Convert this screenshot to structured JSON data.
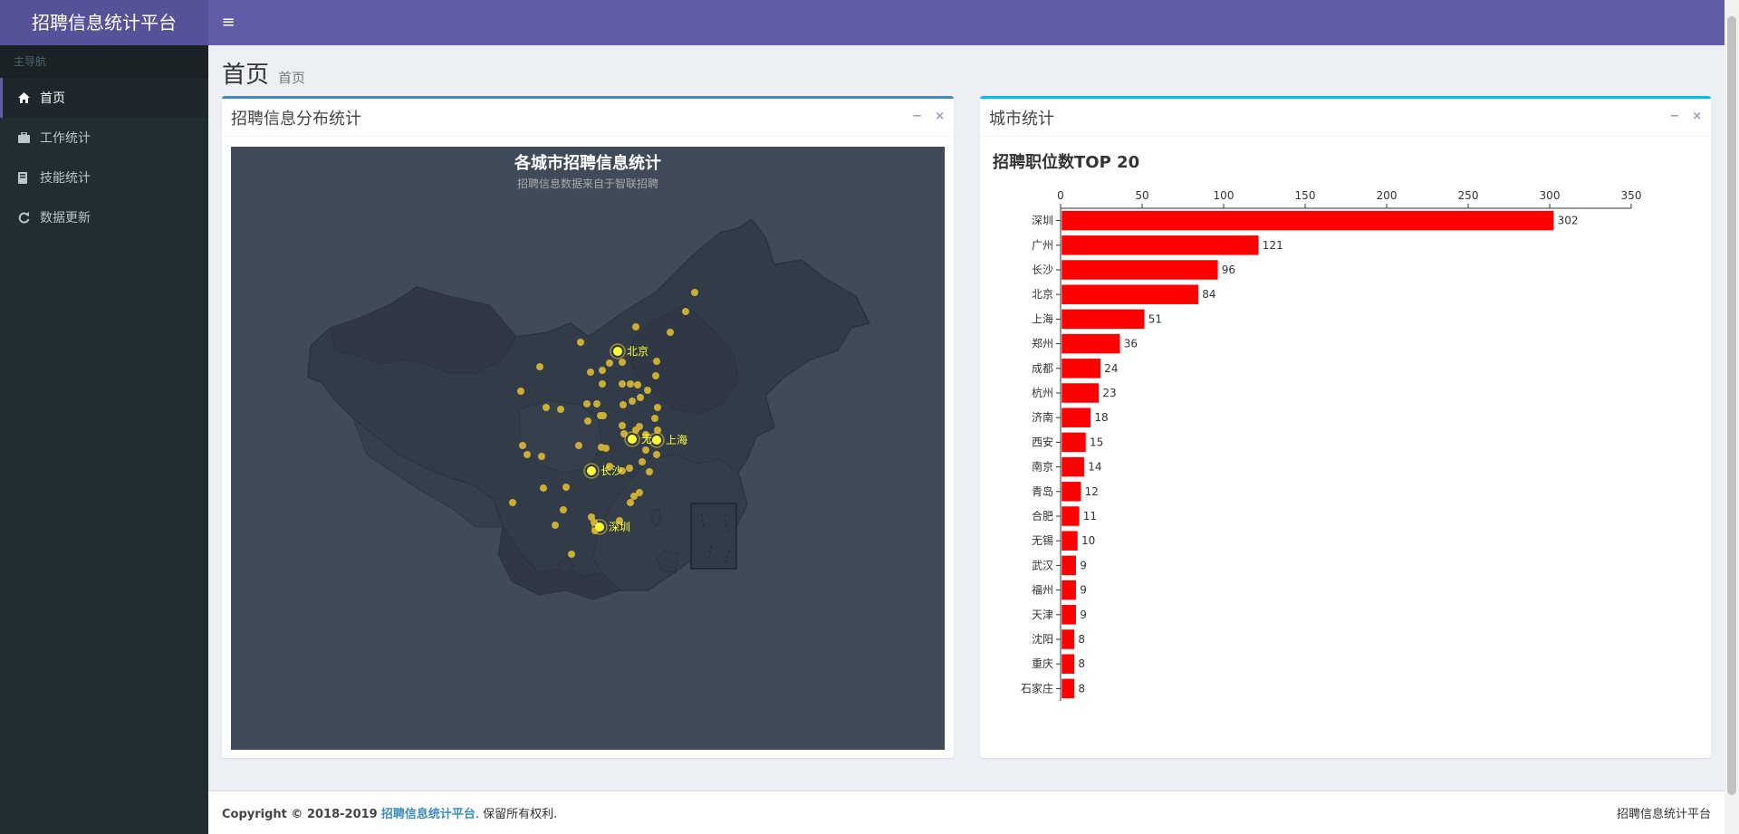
{
  "app": {
    "title": "招聘信息统计平台",
    "toggle": "≡"
  },
  "sidebar": {
    "header": "主导航",
    "items": [
      {
        "label": "首页",
        "icon": "home-icon",
        "active": true
      },
      {
        "label": "工作统计",
        "icon": "briefcase-icon",
        "active": false
      },
      {
        "label": "技能统计",
        "icon": "book-icon",
        "active": false
      },
      {
        "label": "数据更新",
        "icon": "refresh-icon",
        "active": false
      }
    ]
  },
  "content": {
    "title": "首页",
    "subtitle": "首页"
  },
  "map_box": {
    "title": "招聘信息分布统计",
    "map_title": "各城市招聘信息统计",
    "map_subtitle": "招聘信息数据来自于智联招聘",
    "labels": [
      "北京",
      "上海",
      "长沙",
      "深圳",
      "无"
    ]
  },
  "city_box": {
    "title": "城市统计"
  },
  "tools": {
    "minimize": "−",
    "close": "×"
  },
  "chart_data": {
    "type": "bar",
    "orientation": "horizontal",
    "title": "招聘职位数TOP 20",
    "xlim": [
      0,
      350
    ],
    "xticks": [
      0,
      50,
      100,
      150,
      200,
      250,
      300,
      350
    ],
    "categories": [
      "深圳",
      "广州",
      "长沙",
      "北京",
      "上海",
      "郑州",
      "成都",
      "杭州",
      "济南",
      "西安",
      "南京",
      "青岛",
      "合肥",
      "无锡",
      "武汉",
      "福州",
      "天津",
      "沈阳",
      "重庆",
      "石家庄"
    ],
    "values": [
      302,
      121,
      96,
      84,
      51,
      36,
      24,
      23,
      18,
      15,
      14,
      12,
      11,
      10,
      9,
      9,
      9,
      8,
      8,
      8
    ],
    "color": "#ff0000"
  },
  "footer": {
    "copyright": "Copyright © 2018-2019",
    "link": "招聘信息统计平台",
    "rights": ". 保留所有权利.",
    "right_text": "招聘信息统计平台"
  }
}
